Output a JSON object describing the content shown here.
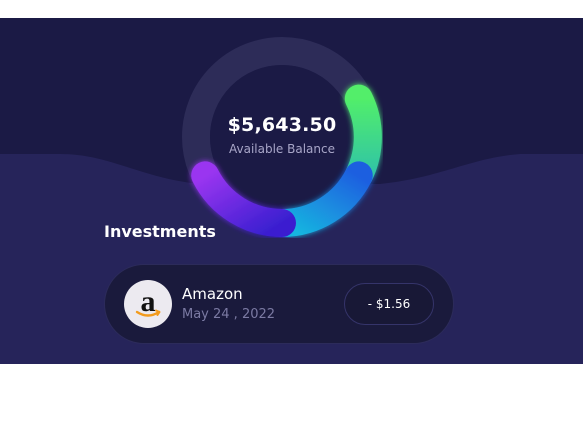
{
  "balance": {
    "amount": "$5,643.50",
    "label": "Available Balance"
  },
  "investments": {
    "title": "Investments",
    "items": [
      {
        "name": "Amazon",
        "date": "May 24 , 2022",
        "amount": "- $1.56",
        "icon": "amazon-logo-icon"
      }
    ]
  },
  "colors": {
    "panel_bg": "#1b1a45",
    "wave_bg": "#26245a",
    "ring_green": "#46e27a",
    "ring_blue": "#1aa3e0",
    "ring_purple": "#8a2be2"
  }
}
